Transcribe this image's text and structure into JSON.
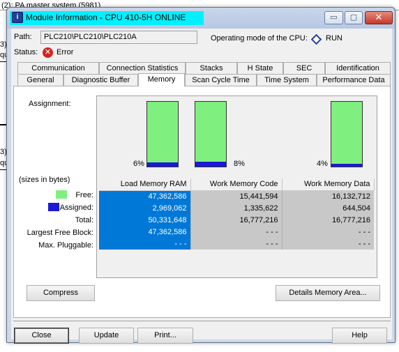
{
  "background": {
    "top_text": "(2): PA master system (5981)",
    "side_labels": [
      "3)",
      "3)"
    ],
    "side_stub": [
      "qu",
      "qu"
    ]
  },
  "window": {
    "title": "Module Information - CPU 410-5H  ONLINE",
    "icon_glyph": "i",
    "controls": {
      "minimize": "▭",
      "maximize": "▢",
      "close": "✕"
    }
  },
  "header": {
    "path_label": "Path:",
    "path_value": "PLC210\\PLC210\\PLC210A",
    "mode_label": "Operating mode of the  CPU:",
    "mode_value": "RUN",
    "status_label": "Status:",
    "status_value": "Error"
  },
  "tabs": {
    "row1": [
      "Communication",
      "Connection Statistics",
      "Stacks",
      "H State",
      "SEC",
      "Identification"
    ],
    "row2": [
      "General",
      "Diagnostic Buffer",
      "Memory",
      "Scan Cycle Time",
      "Time System",
      "Performance Data"
    ],
    "active": "Memory"
  },
  "memory": {
    "assignment_label": "Assignment:",
    "sizes_note": "(sizes in bytes)",
    "bars": [
      {
        "percent_label": "6%",
        "assigned_fraction": 0.06
      },
      {
        "percent_label": "8%",
        "assigned_fraction": 0.08
      },
      {
        "percent_label": "4%",
        "assigned_fraction": 0.04
      }
    ],
    "columns": [
      "Load Memory RAM",
      "Work Memory Code",
      "Work Memory Data"
    ],
    "row_labels": [
      "Free:",
      "Assigned:",
      "Total:",
      "Largest Free Block:",
      "Max. Pluggable:"
    ],
    "rows": [
      [
        "47,362,586",
        "15,441,594",
        "16,132,712"
      ],
      [
        "2,969,062",
        "1,335,622",
        "644,504"
      ],
      [
        "50,331,648",
        "16,777,216",
        "16,777,216"
      ],
      [
        "47,362,586",
        "- - -",
        "- - -"
      ],
      [
        "- - -",
        "- - -",
        "- - -"
      ]
    ],
    "colors": {
      "free": "#7ff07f",
      "assigned": "#1a1ad8",
      "selected_column": "#0078d7"
    }
  },
  "buttons": {
    "compress": "Compress",
    "details": "Details Memory Area...",
    "close": "Close",
    "update": "Update",
    "print": "Print...",
    "help": "Help"
  }
}
